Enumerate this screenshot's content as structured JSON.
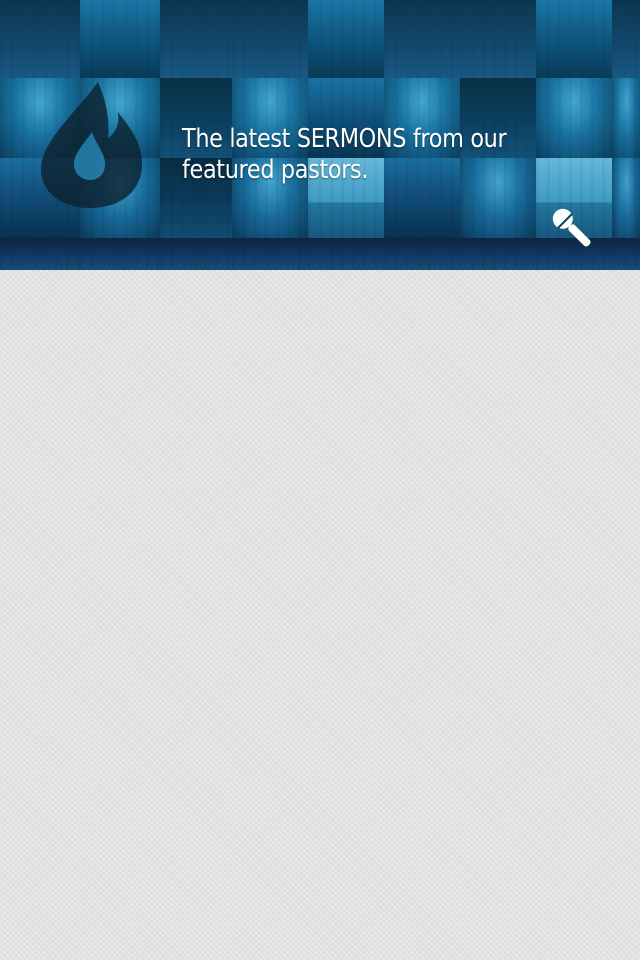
{
  "header": {
    "headline": "The latest SERMONS from our featured pastors.",
    "logo_icon": "flame-drop-icon",
    "mic_icon": "microphone-icon",
    "accent_color": "#1a7fb0"
  },
  "content": {}
}
